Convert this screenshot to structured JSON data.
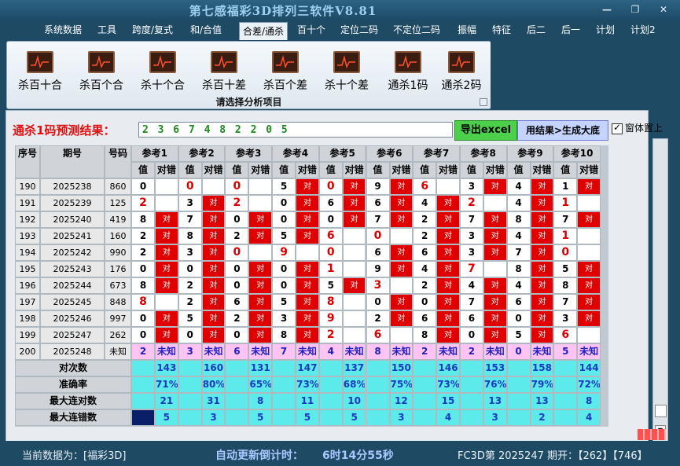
{
  "window": {
    "title": "第七感福彩3D排列三软件V8.81",
    "min": "—",
    "max": "❐",
    "close": "✕"
  },
  "menu": [
    "系统数据",
    "工具",
    "跨度/复式",
    "和/合值",
    "合差/通杀",
    "百十个",
    "定位二码",
    "不定位二码",
    "振幅",
    "特征",
    "后二",
    "后一",
    "计划",
    "计划2"
  ],
  "menu_active": "合差/通杀",
  "ribbon": {
    "buttons": [
      "杀百十合",
      "杀百个合",
      "杀十个合",
      "杀百十差",
      "杀百个差",
      "杀十个差",
      "通杀1码",
      "通杀2码"
    ],
    "caption": "请选择分析项目"
  },
  "prediction": {
    "label": "通杀1码预测结果：",
    "value": "2 3 6 7 4 8 2 2 0 5"
  },
  "buttons": {
    "export": "导出excel",
    "generate": "用结果>生成大底",
    "topmost_label": "窗体置上",
    "topmost_checked": true
  },
  "table": {
    "col_headers": [
      "序号",
      "期号",
      "号码"
    ],
    "groups": [
      "参考1",
      "参考2",
      "参考3",
      "参考4",
      "参考5",
      "参考6",
      "参考7",
      "参考8",
      "参考9",
      "参考10"
    ],
    "sub_headers": [
      "值",
      "对错"
    ],
    "rows": [
      {
        "seq": "190",
        "period": "2025238",
        "num": "860",
        "vals": [
          "0",
          "0",
          "0",
          "5",
          "0",
          "9",
          "6",
          "3",
          "4",
          "1"
        ],
        "hit": [
          0,
          0,
          0,
          1,
          1,
          1,
          0,
          1,
          1,
          1
        ]
      },
      {
        "seq": "191",
        "period": "2025239",
        "num": "125",
        "vals": [
          "2",
          "3",
          "2",
          "0",
          "6",
          "6",
          "4",
          "2",
          "4",
          "1"
        ],
        "hit": [
          0,
          1,
          0,
          1,
          1,
          1,
          1,
          0,
          1,
          0
        ]
      },
      {
        "seq": "192",
        "period": "2025240",
        "num": "419",
        "vals": [
          "8",
          "7",
          "0",
          "0",
          "0",
          "7",
          "2",
          "7",
          "8",
          "7"
        ],
        "hit": [
          1,
          1,
          1,
          1,
          1,
          1,
          1,
          1,
          1,
          1
        ]
      },
      {
        "seq": "193",
        "period": "2025241",
        "num": "160",
        "vals": [
          "2",
          "8",
          "2",
          "5",
          "6",
          "0",
          "2",
          "3",
          "4",
          "1"
        ],
        "hit": [
          1,
          1,
          1,
          1,
          0,
          0,
          1,
          1,
          1,
          0
        ]
      },
      {
        "seq": "194",
        "period": "2025242",
        "num": "990",
        "vals": [
          "2",
          "3",
          "0",
          "9",
          "0",
          "6",
          "6",
          "3",
          "7",
          "0"
        ],
        "hit": [
          1,
          1,
          0,
          0,
          0,
          1,
          1,
          1,
          1,
          0
        ]
      },
      {
        "seq": "195",
        "period": "2025243",
        "num": "176",
        "vals": [
          "0",
          "0",
          "0",
          "0",
          "1",
          "9",
          "4",
          "7",
          "8",
          "5"
        ],
        "hit": [
          1,
          1,
          1,
          1,
          0,
          1,
          1,
          0,
          1,
          1
        ]
      },
      {
        "seq": "196",
        "period": "2025244",
        "num": "673",
        "vals": [
          "8",
          "2",
          "0",
          "0",
          "5",
          "3",
          "2",
          "4",
          "4",
          "8"
        ],
        "hit": [
          1,
          1,
          1,
          1,
          1,
          0,
          1,
          1,
          1,
          1
        ]
      },
      {
        "seq": "197",
        "period": "2025245",
        "num": "848",
        "vals": [
          "8",
          "2",
          "6",
          "5",
          "8",
          "0",
          "0",
          "7",
          "6",
          "7"
        ],
        "hit": [
          0,
          1,
          1,
          1,
          0,
          1,
          1,
          1,
          1,
          1
        ]
      },
      {
        "seq": "198",
        "period": "2025246",
        "num": "997",
        "vals": [
          "0",
          "5",
          "2",
          "3",
          "9",
          "2",
          "6",
          "6",
          "0",
          "3"
        ],
        "hit": [
          1,
          1,
          1,
          1,
          0,
          1,
          1,
          1,
          1,
          1
        ]
      },
      {
        "seq": "199",
        "period": "2025247",
        "num": "262",
        "vals": [
          "0",
          "0",
          "0",
          "8",
          "2",
          "6",
          "8",
          "0",
          "5",
          "6"
        ],
        "hit": [
          1,
          1,
          1,
          1,
          0,
          0,
          1,
          1,
          1,
          0
        ]
      },
      {
        "seq": "200",
        "period": "2025248",
        "num": "未知",
        "vals": [
          "2",
          "3",
          "6",
          "7",
          "4",
          "8",
          "2",
          "2",
          "0",
          "5"
        ],
        "unknown": "未知"
      }
    ],
    "stats": [
      {
        "label": "对次数",
        "values": [
          "143",
          "160",
          "131",
          "147",
          "137",
          "150",
          "146",
          "153",
          "158",
          "144"
        ]
      },
      {
        "label": "准确率",
        "values": [
          "71%",
          "80%",
          "65%",
          "73%",
          "68%",
          "75%",
          "73%",
          "76%",
          "79%",
          "72%"
        ]
      },
      {
        "label": "最大连对数",
        "values": [
          "21",
          "31",
          "8",
          "11",
          "10",
          "12",
          "15",
          "13",
          "13",
          "8"
        ]
      },
      {
        "label": "最大连错数",
        "values": [
          "5",
          "3",
          "5",
          "5",
          "5",
          "3",
          "4",
          "3",
          "2",
          "4"
        ]
      }
    ],
    "hit_label": "对",
    "red_val_rows": [
      [
        0,
        1,
        1,
        0,
        1,
        0,
        1,
        0,
        0,
        0
      ],
      [
        1,
        0,
        1,
        0,
        0,
        0,
        0,
        1,
        0,
        1
      ],
      [
        0,
        0,
        0,
        0,
        0,
        0,
        0,
        0,
        0,
        0
      ],
      [
        0,
        0,
        0,
        0,
        1,
        1,
        0,
        0,
        0,
        1
      ],
      [
        0,
        0,
        1,
        1,
        1,
        0,
        0,
        0,
        0,
        1
      ],
      [
        0,
        0,
        0,
        0,
        1,
        0,
        0,
        1,
        0,
        0
      ],
      [
        0,
        0,
        0,
        0,
        0,
        1,
        0,
        0,
        0,
        0
      ],
      [
        1,
        0,
        0,
        0,
        1,
        0,
        0,
        0,
        0,
        0
      ],
      [
        0,
        0,
        0,
        0,
        1,
        0,
        0,
        0,
        0,
        0
      ],
      [
        0,
        0,
        0,
        0,
        1,
        1,
        0,
        0,
        0,
        1
      ]
    ]
  },
  "status": {
    "current": "当前数据为：[福彩3D]",
    "countdown_label": "自动更新倒计时：",
    "countdown": "6时14分55秒",
    "draw": "FC3D第 2025247 期开：【262】【746】"
  }
}
